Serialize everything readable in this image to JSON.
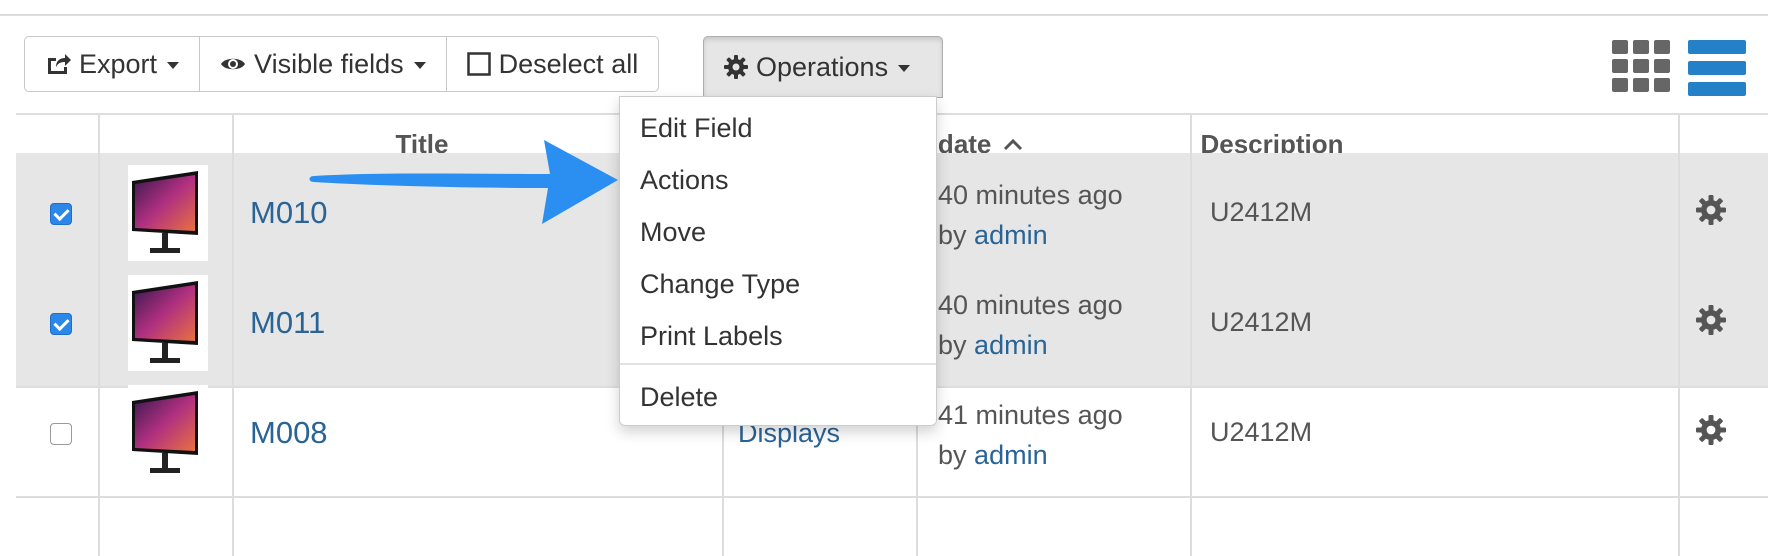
{
  "toolbar": {
    "export_label": "Export",
    "visible_fields_label": "Visible fields",
    "deselect_all_label": "Deselect all",
    "operations_label": "Operations"
  },
  "view_toggle": {
    "grid_icon": "grid-icon",
    "list_icon": "list-icon",
    "active": "list"
  },
  "columns": {
    "title": "Title",
    "last_update": "Last Update",
    "description": "Description"
  },
  "rows": [
    {
      "selected": true,
      "title": "M010",
      "type": "",
      "updated": "40 minutes ago",
      "by_prefix": "by",
      "by_user": "admin",
      "description": "U2412M"
    },
    {
      "selected": true,
      "title": "M011",
      "type": "",
      "updated": "40 minutes ago",
      "by_prefix": "by",
      "by_user": "admin",
      "description": "U2412M"
    },
    {
      "selected": false,
      "title": "M008",
      "type": "Displays",
      "updated": "41 minutes ago",
      "by_prefix": "by",
      "by_user": "admin",
      "description": "U2412M"
    }
  ],
  "operations_menu": {
    "items": [
      "Edit Field",
      "Actions",
      "Move",
      "Change Type",
      "Print Labels"
    ],
    "danger_item": "Delete"
  },
  "colors": {
    "link": "#2a6496",
    "accent": "#2481c8",
    "arrow": "#2b8ff2"
  }
}
